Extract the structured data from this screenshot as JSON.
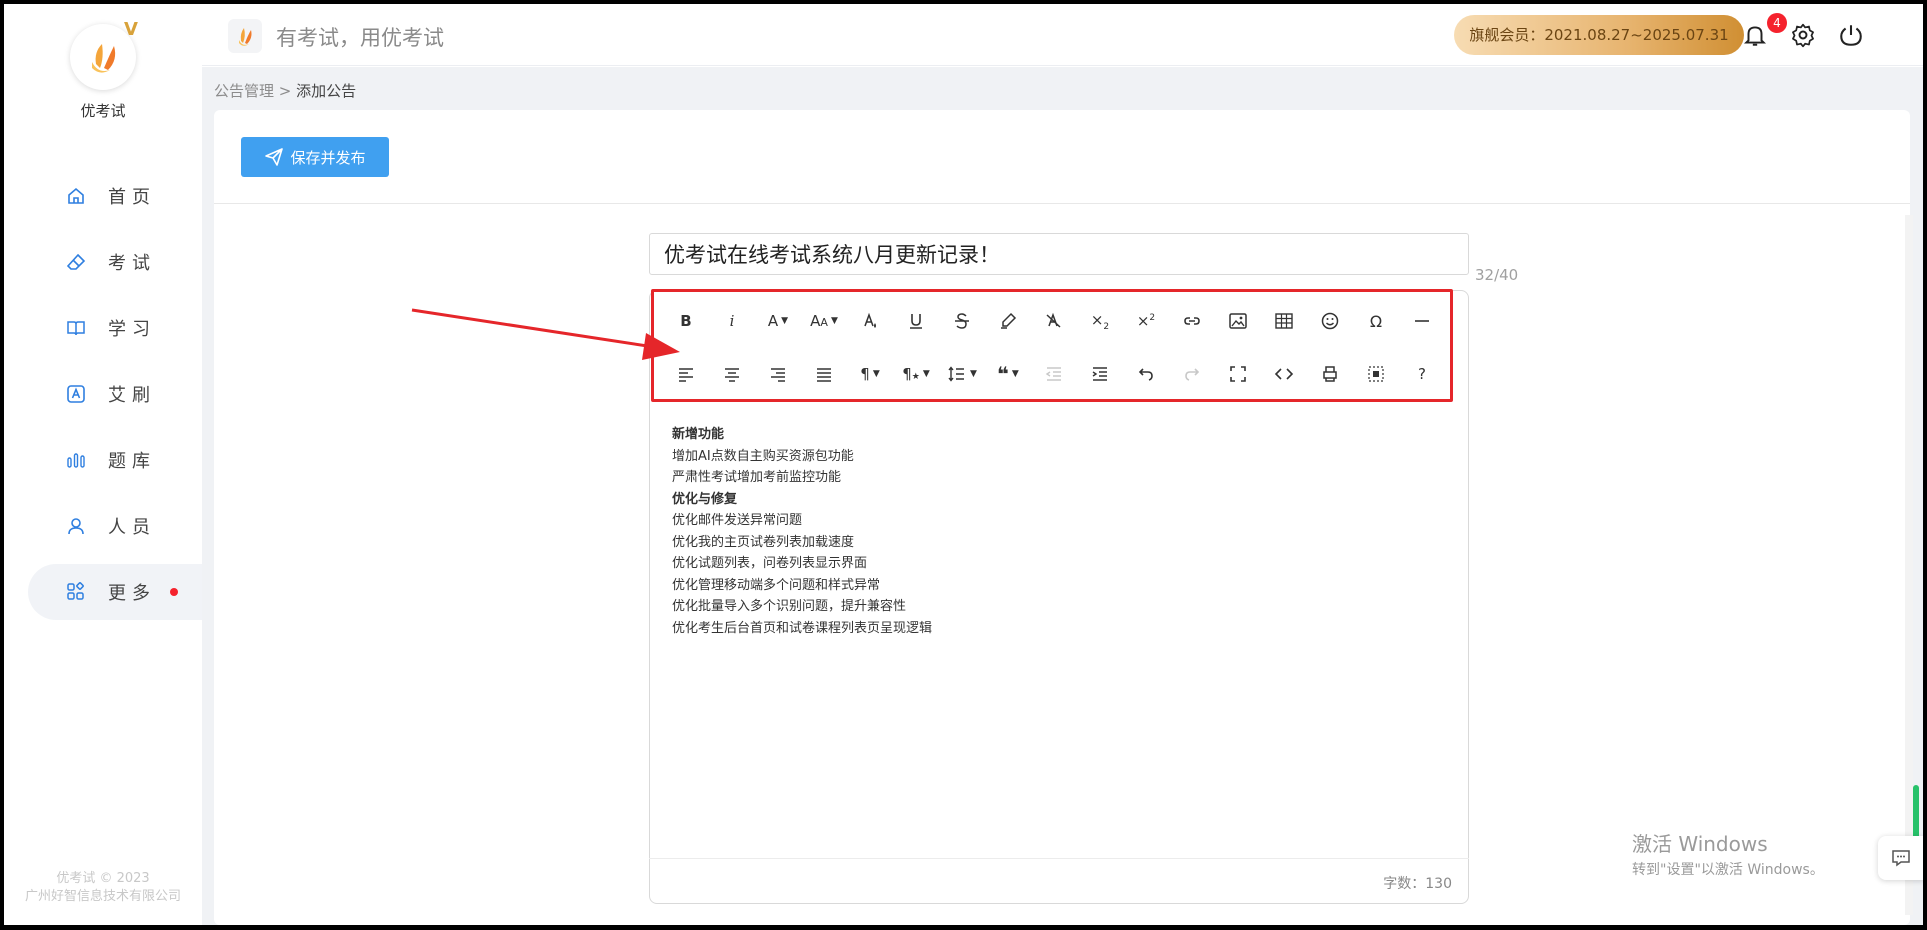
{
  "sidebar": {
    "brand": "优考试",
    "items": [
      {
        "label": "首页",
        "icon": "home-icon"
      },
      {
        "label": "考试",
        "icon": "eraser-icon"
      },
      {
        "label": "学习",
        "icon": "book-icon"
      },
      {
        "label": "艾刷",
        "icon": "letter-a-icon"
      },
      {
        "label": "题库",
        "icon": "bars-icon"
      },
      {
        "label": "人员",
        "icon": "user-icon"
      },
      {
        "label": "更多",
        "icon": "apps-icon",
        "active": true
      }
    ],
    "footer_line1": "优考试 © 2023",
    "footer_line2": "广州好智信息技术有限公司"
  },
  "header": {
    "slogan": "有考试，用优考试",
    "membership": "旗舰会员：2021.08.27~2025.07.31",
    "notification_count": "4"
  },
  "breadcrumb": {
    "parent": "公告管理",
    "separator": " > ",
    "current": "添加公告"
  },
  "toolbar": {
    "publish_label": "保存并发布"
  },
  "editor": {
    "title_value": "优考试在线考试系统八月更新记录！",
    "title_counter": "32/40",
    "word_count": "字数：130",
    "lines": [
      {
        "text": "新增功能",
        "bold": true
      },
      {
        "text": "增加AI点数自主购买资源包功能",
        "bold": false
      },
      {
        "text": "严肃性考试增加考前监控功能",
        "bold": false
      },
      {
        "text": "优化与修复",
        "bold": true
      },
      {
        "text": "优化邮件发送异常问题",
        "bold": false
      },
      {
        "text": "优化我的主页试卷列表加载速度",
        "bold": false
      },
      {
        "text": "优化试题列表，问卷列表显示界面",
        "bold": false
      },
      {
        "text": "优化管理移动端多个问题和样式异常",
        "bold": false
      },
      {
        "text": "优化批量导入多个识别问题，提升兼容性",
        "bold": false
      },
      {
        "text": "优化考生后台首页和试卷课程列表页呈现逻辑",
        "bold": false
      }
    ]
  },
  "watermark": {
    "line1": "激活 Windows",
    "line2": "转到\"设置\"以激活 Windows。"
  },
  "colors": {
    "primary": "#40a0f0",
    "highlight": "#e5262a",
    "badge": "#f5222d"
  }
}
